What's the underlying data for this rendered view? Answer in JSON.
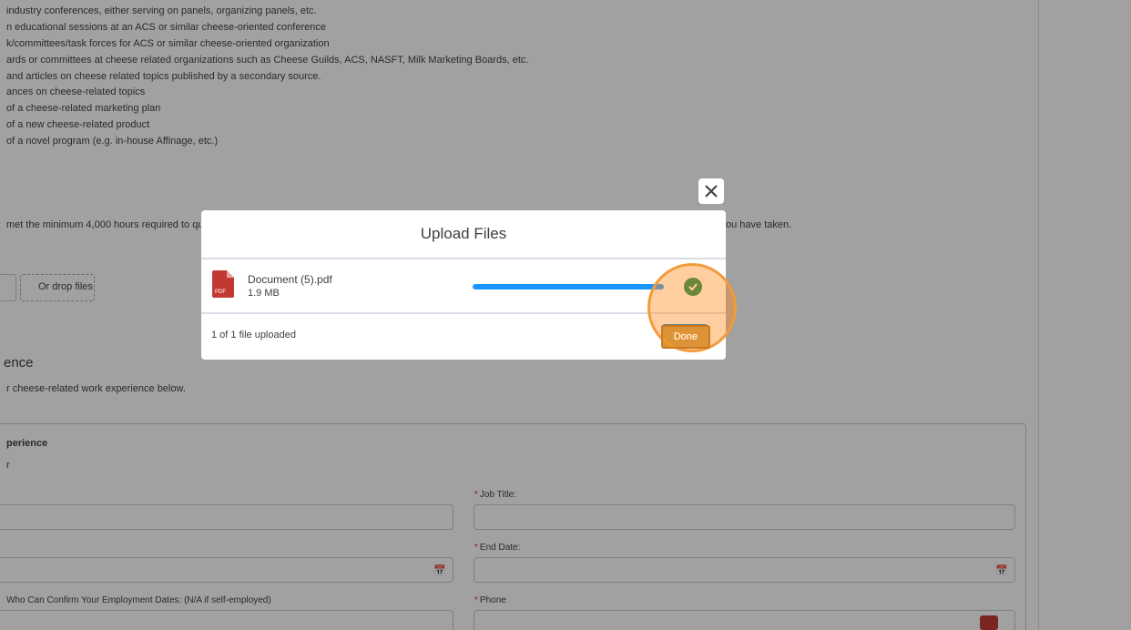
{
  "background": {
    "criteria_lines": [
      "industry conferences, either serving on panels, organizing panels, etc.",
      "n educational sessions at an ACS or similar cheese-oriented conference",
      "k/committees/task forces for ACS or similar cheese-oriented organization",
      "ards or committees at cheese related organizations such as Cheese Guilds, ACS, NASFT, Milk Marketing Boards, etc.",
      " and articles on cheese related topics published by a secondary source.",
      "ances on cheese-related topics",
      " of a cheese-related marketing plan",
      " of a new cheese-related product",
      " of a novel program (e.g. in-house Affinage, etc.)"
    ],
    "hours_line_left": "met the minimum 4,000 hours required to qua",
    "hours_line_right": "ou have taken.",
    "drop_files_text": "Or drop files",
    "section_title": "ence",
    "section_subtitle": "r cheese-related work experience below.",
    "card_title": "perience",
    "card_subtitle": "r",
    "fields": {
      "job_title_label": "Job Title:",
      "end_date_label": "End Date:",
      "contact_label": " Who Can Confirm Your Employment Dates: (N/A if self-employed)",
      "phone_label": "Phone",
      "required_marker": "*"
    }
  },
  "modal": {
    "title": "Upload Files",
    "close_icon": "close-icon",
    "file": {
      "name": "Document (5).pdf",
      "size": "1.9 MB",
      "icon_label": "PDF",
      "progress": 1.0
    },
    "status_text": "1 of 1 file uploaded",
    "done_label": "Done"
  },
  "colors": {
    "progress": "#1b96ff",
    "success": "#04844b",
    "pdf_icon": "#c23934",
    "highlight": "#f39b3a"
  }
}
